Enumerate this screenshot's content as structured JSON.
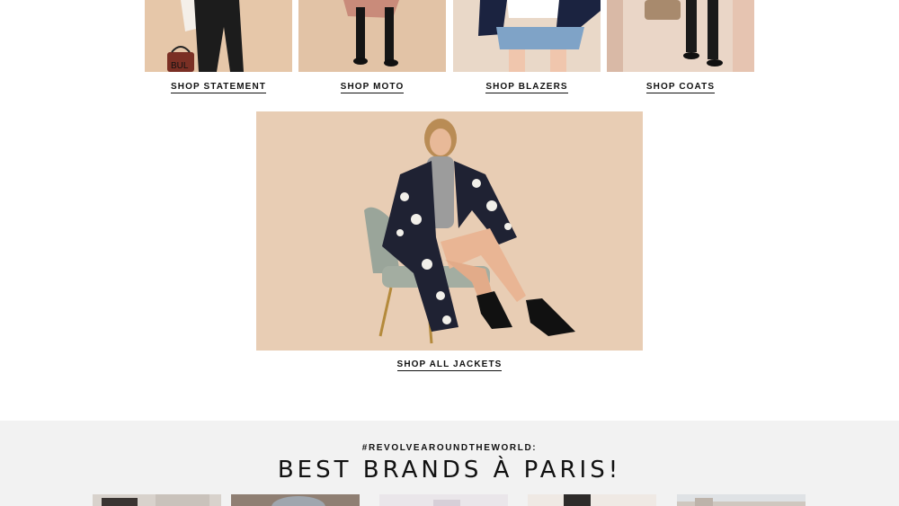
{
  "category_tiles": [
    {
      "label": "SHOP STATEMENT",
      "icon": "statement-jacket-photo",
      "bg": "#e6c7a9"
    },
    {
      "label": "SHOP MOTO",
      "icon": "moto-jacket-photo",
      "bg": "#e2c3a6"
    },
    {
      "label": "SHOP BLAZERS",
      "icon": "blazer-photo",
      "bg": "#e9d8c8"
    },
    {
      "label": "SHOP COATS",
      "icon": "coat-photo",
      "bg": "#ead6c7"
    }
  ],
  "hero": {
    "link_label": "SHOP ALL JACKETS",
    "icon": "model-seated-floral-coat-photo",
    "bg": "#e8cdb4"
  },
  "world_section": {
    "hashtag": "#REVOLVEAROUNDTHEWORLD:",
    "title": "BEST BRANDS À PARIS!",
    "bg": "#f2f2f2",
    "thumbnails": [
      {
        "icon": "paris-photo-1"
      },
      {
        "icon": "paris-photo-2"
      },
      {
        "icon": "paris-photo-3"
      },
      {
        "icon": "paris-photo-4"
      },
      {
        "icon": "paris-photo-5"
      }
    ]
  }
}
